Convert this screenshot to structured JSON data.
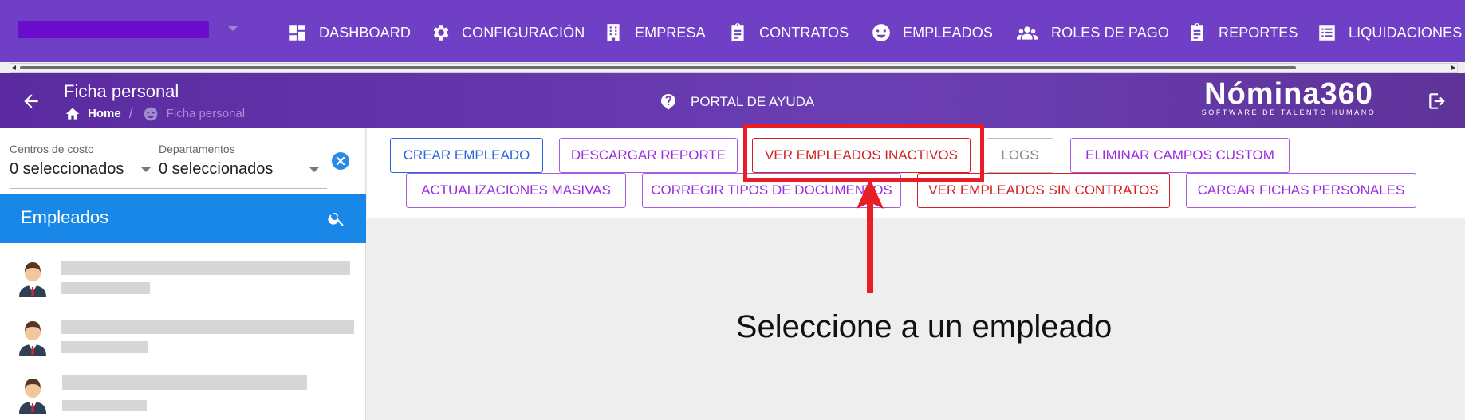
{
  "company": {
    "name": ""
  },
  "nav": {
    "items": [
      {
        "label": "DASHBOARD",
        "icon": "dashboard-icon"
      },
      {
        "label": "CONFIGURACIÓN",
        "icon": "gear-icon"
      },
      {
        "label": "EMPRESA",
        "icon": "building-icon"
      },
      {
        "label": "CONTRATOS",
        "icon": "clipboard-icon"
      },
      {
        "label": "EMPLEADOS",
        "icon": "face-icon"
      },
      {
        "label": "ROLES DE PAGO",
        "icon": "group-icon"
      },
      {
        "label": "REPORTES",
        "icon": "report-icon"
      },
      {
        "label": "LIQUIDACIONES",
        "icon": "list-icon"
      }
    ]
  },
  "header": {
    "title": "Ficha personal",
    "breadcrumb": {
      "home": "Home",
      "separator": "/",
      "current": "Ficha personal"
    },
    "help_label": "PORTAL DE AYUDA",
    "logo": {
      "main": "Nómina360",
      "sub": "SOFTWARE DE TALENTO HUMANO"
    }
  },
  "filters": {
    "cost_centers": {
      "label": "Centros de costo",
      "value": "0 seleccionados"
    },
    "departments": {
      "label": "Departamentos",
      "value": "0 seleccionados"
    }
  },
  "employees": {
    "title": "Empleados",
    "count_visible": 3
  },
  "actions": {
    "row1": [
      {
        "label": "CREAR EMPLEADO",
        "style": "blue"
      },
      {
        "label": "DESCARGAR REPORTE",
        "style": "purple"
      },
      {
        "label": "VER EMPLEADOS INACTIVOS",
        "style": "red"
      },
      {
        "label": "LOGS",
        "style": "gray"
      },
      {
        "label": "ELIMINAR CAMPOS CUSTOM",
        "style": "purple"
      }
    ],
    "row2": [
      {
        "label": "ACTUALIZACIONES MASIVAS",
        "style": "purple"
      },
      {
        "label": "CORREGIR TIPOS DE DOCUMENTOS",
        "style": "purple"
      },
      {
        "label": "VER EMPLEADOS SIN CONTRATOS",
        "style": "red"
      },
      {
        "label": "CARGAR FICHAS PERSONALES",
        "style": "purple"
      }
    ]
  },
  "main": {
    "empty_message": "Seleccione a un empleado"
  },
  "colors": {
    "nav_bg": "#6f3fc5",
    "primary_blue": "#1887e8",
    "annotation_red": "#e81d25",
    "button_purple": "#9b2de0",
    "button_red": "#d32121"
  }
}
